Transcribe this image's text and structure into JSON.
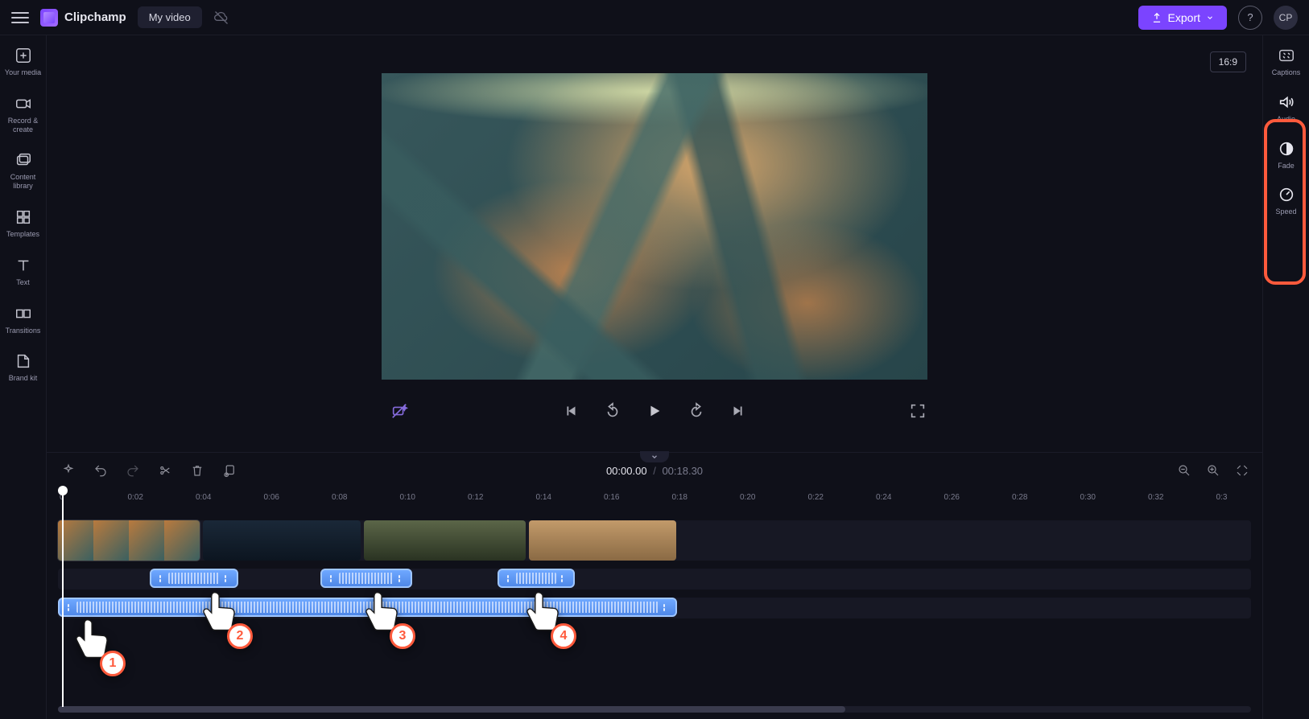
{
  "app": {
    "name": "Clipchamp"
  },
  "header": {
    "project_title": "My video",
    "export_label": "Export",
    "avatar_initials": "CP"
  },
  "left_rail": {
    "items": [
      {
        "label": "Your media",
        "icon": "plus-square-icon"
      },
      {
        "label": "Record & create",
        "icon": "camera-icon"
      },
      {
        "label": "Content library",
        "icon": "images-icon"
      },
      {
        "label": "Templates",
        "icon": "grid-icon"
      },
      {
        "label": "Text",
        "icon": "text-icon"
      },
      {
        "label": "Transitions",
        "icon": "transition-icon"
      },
      {
        "label": "Brand kit",
        "icon": "brand-icon"
      }
    ]
  },
  "right_rail": {
    "items": [
      {
        "label": "Captions",
        "icon": "cc-icon"
      },
      {
        "label": "Audio",
        "icon": "speaker-icon"
      },
      {
        "label": "Fade",
        "icon": "fade-icon"
      },
      {
        "label": "Speed",
        "icon": "gauge-icon"
      }
    ]
  },
  "stage": {
    "aspect_label": "16:9"
  },
  "playback": {
    "current_time": "00:00.00",
    "duration": "00:18.30"
  },
  "ruler": {
    "ticks": [
      "0",
      "0:02",
      "0:04",
      "0:06",
      "0:08",
      "0:10",
      "0:12",
      "0:14",
      "0:16",
      "0:18",
      "0:20",
      "0:22",
      "0:24",
      "0:26",
      "0:28",
      "0:30",
      "0:32",
      "0:3"
    ]
  },
  "annotations": {
    "cursor_badges": [
      "1",
      "2",
      "3",
      "4"
    ]
  }
}
